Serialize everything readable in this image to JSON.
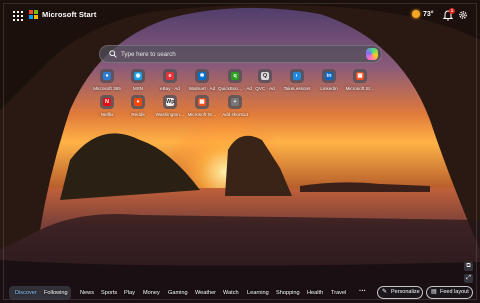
{
  "header": {
    "brand": "Microsoft Start",
    "logo_colors": [
      "#f25022",
      "#7fba00",
      "#00a4ef",
      "#ffb900"
    ],
    "temperature": "73°",
    "notification_count": "1"
  },
  "search": {
    "placeholder": "Type here to search"
  },
  "tiles": [
    {
      "label": "Microsoft 365",
      "icon": "microsoft-365-icon",
      "color": "#2b7cd3",
      "glyph": "●"
    },
    {
      "label": "MSN",
      "icon": "msn-icon",
      "color": "#1ba1e2",
      "glyph": "◉"
    },
    {
      "label": "eBay · Ad",
      "icon": "ebay-icon",
      "color": "#e53238",
      "glyph": "e"
    },
    {
      "label": "Walmart · Ad",
      "icon": "walmart-icon",
      "color": "#0071ce",
      "glyph": "✱"
    },
    {
      "label": "QuickBoo… · Ad",
      "icon": "quickbooks-icon",
      "color": "#2ca01c",
      "glyph": "q"
    },
    {
      "label": "QVC · Ad",
      "icon": "qvc-icon",
      "color": "#dddddd",
      "glyph": "Q"
    },
    {
      "label": "TakeLessons",
      "icon": "takelessons-icon",
      "color": "#1e88e5",
      "glyph": "◐"
    },
    {
      "label": "LinkedIn",
      "icon": "linkedin-icon",
      "color": "#0a66c2",
      "glyph": "in"
    },
    {
      "label": "Microsoft St…",
      "icon": "microsoft-store-icon",
      "color": "#f25022",
      "glyph": "▦"
    },
    {
      "label": "Netflix",
      "icon": "netflix-icon",
      "color": "#e50914",
      "glyph": "N"
    },
    {
      "label": "Reddit",
      "icon": "reddit-icon",
      "color": "#ff4500",
      "glyph": "●"
    },
    {
      "label": "Washington…",
      "icon": "washington-post-icon",
      "color": "#f0f0f0",
      "glyph": "Wp"
    },
    {
      "label": "Microsoft St…",
      "icon": "microsoft-store-icon",
      "color": "#f25022",
      "glyph": "▦"
    },
    {
      "label": "Add shortcut",
      "icon": "plus-icon",
      "color": "#777777",
      "glyph": "+"
    }
  ],
  "footer": {
    "categories": [
      "Discover",
      "Following",
      "News",
      "Sports",
      "Play",
      "Money",
      "Gaming",
      "Weather",
      "Watch",
      "Learning",
      "Shopping",
      "Health",
      "Travel"
    ],
    "more": "···",
    "personalize": "Personalize",
    "feed_layout": "Feed layout"
  }
}
